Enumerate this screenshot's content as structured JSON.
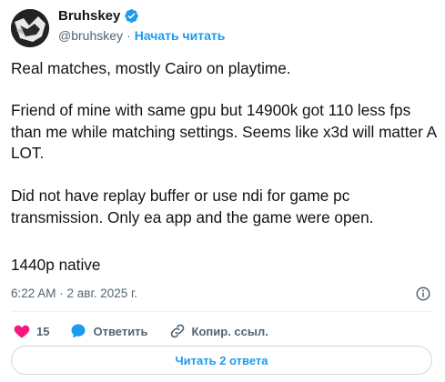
{
  "author": {
    "name": "Bruhskey",
    "handle": "@bruhskey",
    "separator": "·",
    "follow_label": "Начать читать"
  },
  "tweet": {
    "paragraphs": [
      "Real matches, mostly Cairo on playtime.",
      "Friend of mine with same gpu but 14900k got 110 less fps than me while matching settings. Seems like x3d will matter A LOT.",
      "Did not have replay buffer or use ndi for game pc transmission. Only ea app and the game were open.",
      "1440p native"
    ],
    "timestamp": "6:22 AM · 2 авг. 2025 г."
  },
  "actions": {
    "like_count": "15",
    "reply_label": "Ответить",
    "copy_link_label": "Копир. ссыл."
  },
  "read_replies_label": "Читать 2 ответа",
  "colors": {
    "accent": "#1d9bf0",
    "like": "#f91880",
    "text": "#0f1419",
    "muted": "#536471"
  },
  "icons": [
    "avatar-image",
    "verified-badge-icon",
    "info-icon",
    "heart-icon",
    "reply-bubble-icon",
    "link-icon"
  ]
}
